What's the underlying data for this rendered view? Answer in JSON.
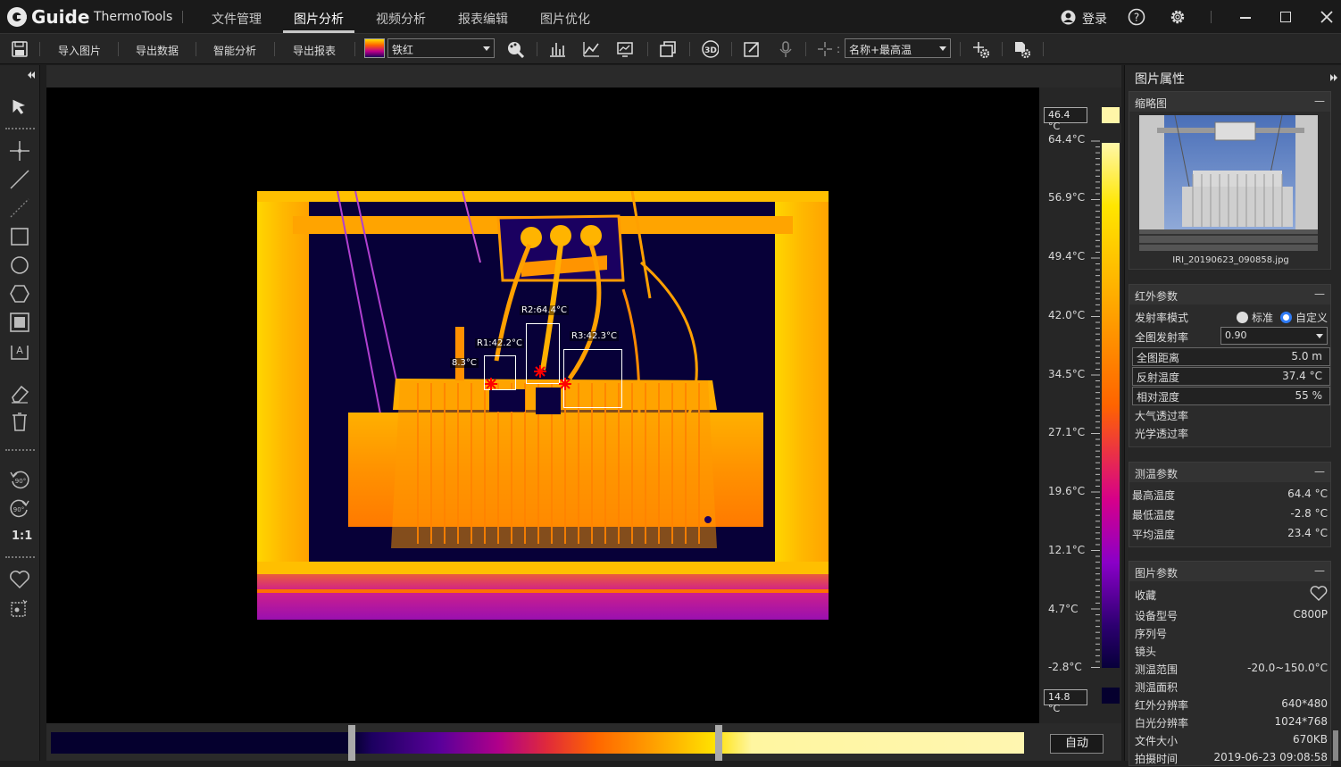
{
  "app": {
    "brand": "Guide",
    "name": "ThermoTools",
    "nav_tabs": [
      "文件管理",
      "图片分析",
      "视频分析",
      "报表编辑",
      "图片优化"
    ],
    "active_tab": "图片分析",
    "login": "登录"
  },
  "toolbar": {
    "import": "导入图片",
    "export_data": "导出数据",
    "smart_analysis": "智能分析",
    "export_report": "导出报表",
    "palette": "铁红",
    "label_mode": "名称+最高温"
  },
  "image_labels": {
    "r1": "R1:42.2°C",
    "r2": "R2:64.4°C",
    "r3": "R3:42.3°C",
    "spot": "8.3°C"
  },
  "scale": {
    "max_box": "46.4 °C",
    "min_box": "14.8 °C",
    "ticks": [
      "64.4°C",
      "56.9°C",
      "49.4°C",
      "42.0°C",
      "34.5°C",
      "27.1°C",
      "19.6°C",
      "12.1°C",
      "4.7°C",
      "-2.8°C"
    ],
    "auto": "自动"
  },
  "panel": {
    "title": "图片属性",
    "thumb": {
      "head": "缩略图",
      "filename": "IRI_20190623_090858.jpg"
    },
    "ir_params": {
      "head": "红外参数",
      "emissivity_mode": "发射率模式",
      "opt_standard": "标准",
      "opt_custom": "自定义",
      "global_emissivity": "全图发射率",
      "global_emissivity_value": "0.90",
      "global_distance": "全图距离",
      "global_distance_value": "5.0  m",
      "reflected_temp": "反射温度",
      "reflected_temp_value": "37.4 °C",
      "humidity": "相对湿度",
      "humidity_value": "55  %",
      "atm_trans": "大气透过率",
      "opt_trans": "光学透过率"
    },
    "meas_params": {
      "head": "测温参数",
      "max_label": "最高温度",
      "max_value": "64.4 °C",
      "min_label": "最低温度",
      "min_value": "-2.8  °C",
      "avg_label": "平均温度",
      "avg_value": "23.4 °C"
    },
    "image_params": {
      "head": "图片参数",
      "favorite": "收藏",
      "device_model": "设备型号",
      "device_model_value": "C800P",
      "serial": "序列号",
      "lens": "镜头",
      "range": "测温范围",
      "range_value": "-20.0~150.0°C",
      "area": "测温面积",
      "ir_res": "红外分辨率",
      "ir_res_value": "640*480",
      "vis_res": "白光分辨率",
      "vis_res_value": "1024*768",
      "size": "文件大小",
      "size_value": "670KB",
      "time": "拍摄时间",
      "time_value": "2019-06-23 09:08:58"
    }
  },
  "colors": {
    "accent_radio": "#2f7bf5",
    "dark_bg": "#1e1e1e"
  }
}
